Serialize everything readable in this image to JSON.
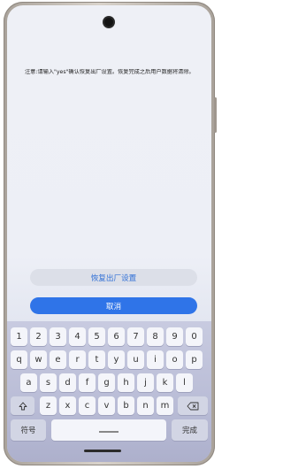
{
  "notice": "注意:请输入\"yes\"确认恢复出厂设置。恢复完成之后用户数据将清除。",
  "buttons": {
    "reset": "恢复出厂设置",
    "cancel": "取消"
  },
  "keyboard": {
    "row_numbers": [
      "1",
      "2",
      "3",
      "4",
      "5",
      "6",
      "7",
      "8",
      "9",
      "0"
    ],
    "row_top": [
      "q",
      "w",
      "e",
      "r",
      "t",
      "y",
      "u",
      "i",
      "o",
      "p"
    ],
    "row_middle": [
      "a",
      "s",
      "d",
      "f",
      "g",
      "h",
      "j",
      "k",
      "l"
    ],
    "row_bottom": [
      "z",
      "x",
      "c",
      "v",
      "b",
      "n",
      "m"
    ],
    "symbols_label": "符号",
    "done_label": "完成",
    "shift_icon": "shift-icon",
    "backspace_icon": "backspace-icon"
  },
  "colors": {
    "accent": "#2f74e8",
    "reset_text": "#2f6fd6"
  }
}
